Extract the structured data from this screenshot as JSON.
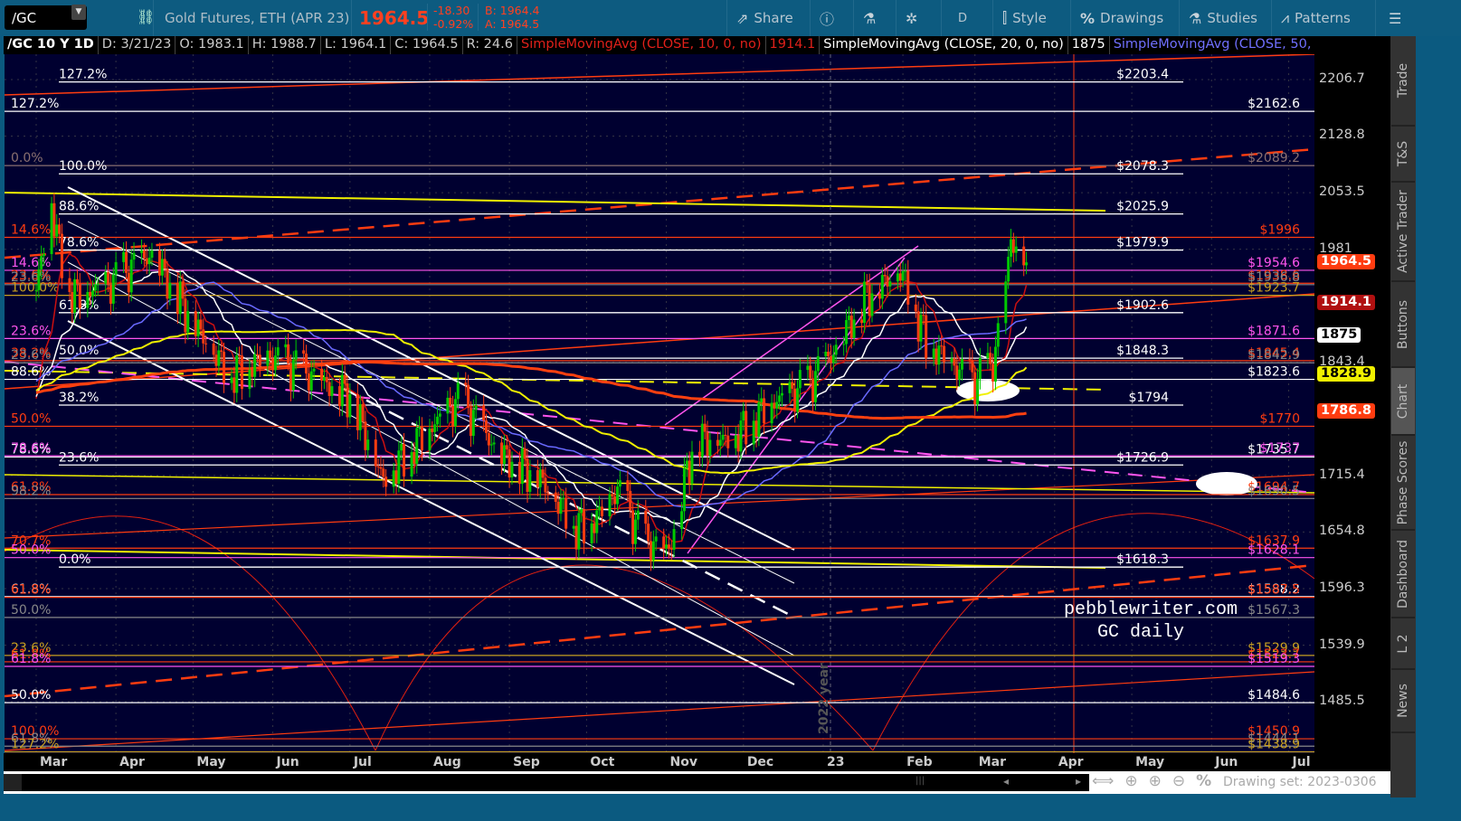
{
  "topbar": {
    "symbol": "/GC",
    "description": "Gold Futures, ETH (APR 23)",
    "last": "1964.5",
    "change": "-18.30",
    "change_pct": "-0.92%",
    "bid": "B: 1964.4",
    "ask": "A: 1964.5",
    "buttons": [
      {
        "label": "Share",
        "icon": "share-icon"
      },
      {
        "label": "",
        "icon": "info-icon"
      },
      {
        "label": "",
        "icon": "flask-icon"
      },
      {
        "label": "",
        "icon": "gear-icon"
      },
      {
        "label": "D",
        "icon": ""
      },
      {
        "label": "Style",
        "icon": "candle-icon"
      },
      {
        "label": "Drawings",
        "icon": "percent-icon"
      },
      {
        "label": "Studies",
        "icon": "flask-icon"
      },
      {
        "label": "Patterns",
        "icon": "pattern-icon"
      },
      {
        "label": "",
        "icon": "menu-icon"
      }
    ]
  },
  "header": {
    "title": "/GC 10 Y 1D",
    "date": "D: 3/21/23",
    "open": "O: 1983.1",
    "high": "H: 1988.7",
    "low": "L: 1964.1",
    "close": "C: 1964.5",
    "range": "R: 24.6",
    "studies": [
      {
        "label": "SimpleMovingAvg (CLOSE, 10, 0, no)",
        "value": "1914.1",
        "color": "#e0201a"
      },
      {
        "label": "SimpleMovingAvg (CLOSE, 20, 0, no)",
        "value": "1875",
        "color": "#ffffff"
      },
      {
        "label": "SimpleMovingAvg (CLOSE, 50, 0,...",
        "value": "",
        "color": "#7070ff"
      }
    ]
  },
  "side_tabs": [
    "Trade",
    "T&S",
    "Active Trader",
    "Buttons",
    "Chart",
    "Phase Scores",
    "Dashboard",
    "L 2",
    "News"
  ],
  "selected_tab": "Chart",
  "bottom": {
    "drawing_set": "Drawing set: 2023-0306"
  },
  "watermark": {
    "line1": "pebblewriter.com",
    "line2": "GC daily",
    "year_label": "2022 year"
  },
  "chart_data": {
    "type": "candlestick",
    "scale": "log",
    "ylim": [
      1410,
      2260
    ],
    "y_ticks": [
      "2206.7",
      "2128.8",
      "2053.5",
      "1981",
      "1843.4",
      "1715.4",
      "1654.8",
      "1596.3",
      "1539.9",
      "1485.5"
    ],
    "x_ticks": [
      "Mar",
      "Apr",
      "May",
      "Jun",
      "Jul",
      "Aug",
      "Sep",
      "Oct",
      "Nov",
      "Dec",
      "23",
      "Feb",
      "Mar",
      "Apr",
      "May",
      "Jun",
      "Jul"
    ],
    "price_badges": [
      {
        "value": "1964.5",
        "bg": "#ff3c10",
        "fg": "#fff"
      },
      {
        "value": "1914.1",
        "bg": "#b01010",
        "fg": "#fff"
      },
      {
        "value": "1875",
        "bg": "#ffffff",
        "fg": "#000"
      },
      {
        "value": "1828.9",
        "bg": "#f0f000",
        "fg": "#000"
      },
      {
        "value": "1786.8",
        "bg": "#ff3c10",
        "fg": "#fff"
      }
    ],
    "price_anchors_days_from_2022_03_01": [
      [
        0,
        1930
      ],
      [
        6,
        2045
      ],
      [
        8,
        1995
      ],
      [
        14,
        1925
      ],
      [
        28,
        1935
      ],
      [
        45,
        1975
      ],
      [
        60,
        1895
      ],
      [
        75,
        1830
      ],
      [
        90,
        1850
      ],
      [
        105,
        1830
      ],
      [
        122,
        1805
      ],
      [
        135,
        1710
      ],
      [
        150,
        1760
      ],
      [
        165,
        1800
      ],
      [
        180,
        1740
      ],
      [
        195,
        1715
      ],
      [
        210,
        1660
      ],
      [
        218,
        1670
      ],
      [
        226,
        1700
      ],
      [
        236,
        1645
      ],
      [
        246,
        1635
      ],
      [
        256,
        1755
      ],
      [
        270,
        1755
      ],
      [
        285,
        1795
      ],
      [
        300,
        1815
      ],
      [
        310,
        1855
      ],
      [
        322,
        1920
      ],
      [
        336,
        1955
      ],
      [
        346,
        1870
      ],
      [
        360,
        1830
      ],
      [
        366,
        1820
      ],
      [
        372,
        1840
      ],
      [
        376,
        1915
      ],
      [
        379,
        1990
      ],
      [
        384,
        1983
      ],
      [
        385,
        1964.5
      ]
    ],
    "last_close": 1964.5,
    "sma_periods": [
      {
        "period": 10,
        "color": "#cc1010"
      },
      {
        "period": 20,
        "color": "#ffffff"
      },
      {
        "period": 50,
        "color": "#6a6aff"
      },
      {
        "period": 100,
        "color": "#f0f000"
      },
      {
        "period": 200,
        "color": "#ff4010"
      }
    ],
    "fib_set_1": [
      {
        "price": 2203.4,
        "label": "$2203.4",
        "pct": "127.2%"
      },
      {
        "price": 2078.3,
        "label": "$2078.3",
        "pct": "100.0%"
      },
      {
        "price": 2025.9,
        "label": "$2025.9",
        "pct": "88.6%"
      },
      {
        "price": 1979.9,
        "label": "$1979.9",
        "pct": "78.6%"
      },
      {
        "price": 1902.6,
        "label": "$1902.6",
        "pct": "61.8%"
      },
      {
        "price": 1848.3,
        "label": "$1848.3",
        "pct": "50.0%"
      },
      {
        "price": 1794,
        "label": "$1794",
        "pct": "38.2%"
      },
      {
        "price": 1726.9,
        "label": "$1726.9",
        "pct": "23.6%"
      },
      {
        "price": 1618.3,
        "label": "$1618.3",
        "pct": "0.0%"
      }
    ],
    "fib_set_2": [
      {
        "price": 2162.6,
        "label": "$2162.6",
        "pct": "127.2%",
        "color": "#ffffff"
      },
      {
        "price": 2089.2,
        "label": "$2089.2",
        "pct": "0.0%",
        "color": "#8a7070"
      },
      {
        "price": 1996,
        "label": "$1996",
        "pct": "14.6%",
        "color": "#ff3c10"
      },
      {
        "price": 1954.6,
        "label": "$1954.6",
        "pct": "14.6%",
        "color": "#ff55ee"
      },
      {
        "price": 1938.6,
        "label": "$1938.6",
        "pct": "23.6%",
        "color": "#ff3c10"
      },
      {
        "price": 1936.8,
        "label": "$1936.8",
        "pct": "23.6%",
        "color": "#888888"
      },
      {
        "price": 1923.7,
        "label": "$1923.7",
        "pct": "100.0%",
        "color": "#c8a020"
      },
      {
        "price": 1871.6,
        "label": "$1871.6",
        "pct": "23.6%",
        "color": "#ff55ee"
      },
      {
        "price": 1845.4,
        "label": "$1845.4",
        "pct": "38.2%",
        "color": "#ff3c10"
      },
      {
        "price": 1842.9,
        "label": "$1842.9",
        "pct": "23.6%",
        "color": "#888888"
      },
      {
        "price": 1823.6,
        "label": "$1823.6",
        "pct": "88.6%",
        "color": "#ffffff"
      },
      {
        "price": 1770,
        "label": "$1770",
        "pct": "50.0%",
        "color": "#ff3c10"
      },
      {
        "price": 1735.7,
        "label": "$1735.7",
        "pct": "78.6%",
        "color": "#ffffff"
      },
      {
        "price": 1737,
        "label": "$1737",
        "pct": "78.6%",
        "color": "#ff55ee"
      },
      {
        "price": 1694.7,
        "label": "$1694.7",
        "pct": "61.8%",
        "color": "#ff3c10"
      },
      {
        "price": 1690.5,
        "label": "$1690.5",
        "pct": "98.2%",
        "color": "#888888"
      },
      {
        "price": 1637.9,
        "label": "$1637.9",
        "pct": "70.7%",
        "color": "#ff3c10"
      },
      {
        "price": 1628.1,
        "label": "$1628.1",
        "pct": "50.0%",
        "color": "#ff55ee"
      },
      {
        "price": 1588.2,
        "label": "$1588.2",
        "pct": "61.8%",
        "color": "#ffffff"
      },
      {
        "price": 1587.5,
        "label": "$1587.5",
        "pct": "61.8%",
        "color": "#ff3c10"
      },
      {
        "price": 1567.3,
        "label": "$1567.3",
        "pct": "50.0%",
        "color": "#888888"
      },
      {
        "price": 1529.9,
        "label": "$1529.9",
        "pct": "23.6%",
        "color": "#c8a020"
      },
      {
        "price": 1523.7,
        "label": "$1523.7",
        "pct": "61.8%",
        "color": "#ff3c10"
      },
      {
        "price": 1519.3,
        "label": "$1519.3",
        "pct": "61.8%",
        "color": "#ff55ee"
      },
      {
        "price": 1484.6,
        "label": "$1484.6",
        "pct": "50.0%",
        "color": "#ffffff"
      },
      {
        "price": 1450.9,
        "label": "$1450.9",
        "pct": "100.0%",
        "color": "#ff3c10"
      },
      {
        "price": 1444.1,
        "label": "$1444.1",
        "pct": "61.8%",
        "color": "#888888"
      },
      {
        "price": 1438.9,
        "label": "$1438.9",
        "pct": "127.2%",
        "color": "#c8a020"
      }
    ]
  }
}
